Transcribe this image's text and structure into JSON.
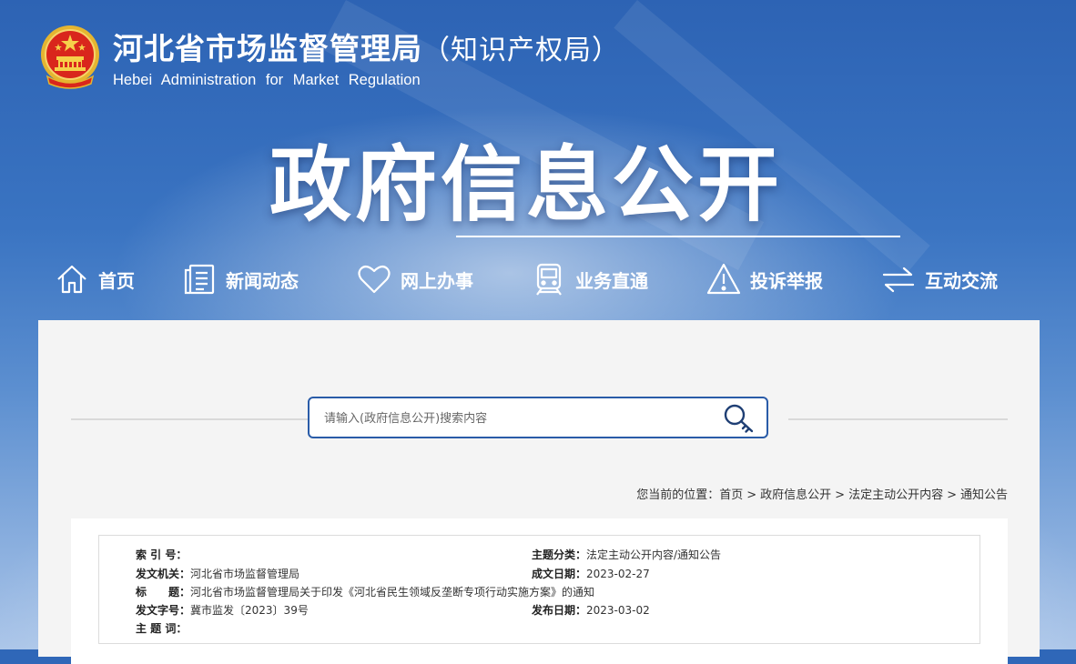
{
  "header": {
    "title": "河北省市场监督管理局",
    "title_paren": "（知识产权局）",
    "subtitle": "Hebei Administration for Market Regulation",
    "banner": "政府信息公开"
  },
  "nav": {
    "items": [
      {
        "label": "首页",
        "icon": "home-icon"
      },
      {
        "label": "新闻动态",
        "icon": "news-icon"
      },
      {
        "label": "网上办事",
        "icon": "heart-icon"
      },
      {
        "label": "业务直通",
        "icon": "train-icon"
      },
      {
        "label": "投诉举报",
        "icon": "warning-icon"
      },
      {
        "label": "互动交流",
        "icon": "swap-arrows-icon"
      }
    ]
  },
  "search": {
    "placeholder": "请输入(政府信息公开)搜索内容",
    "icon": "search-key-icon"
  },
  "breadcrumb": {
    "prefix": "您当前的位置：",
    "items": [
      "首页",
      "政府信息公开",
      "法定主动公开内容",
      "通知公告"
    ],
    "separator": ">"
  },
  "meta": {
    "index_label": "索 引 号：",
    "index_value": "",
    "category_label": "主题分类：",
    "category_value": "法定主动公开内容/通知公告",
    "issuer_label": "发文机关：",
    "issuer_value": "河北省市场监督管理局",
    "created_label": "成文日期：",
    "created_value": "2023-02-27",
    "title_label": "标　　题：",
    "title_value": "河北省市场监督管理局关于印发《河北省民生领域反垄断专项行动实施方案》的通知",
    "docno_label": "发文字号：",
    "docno_value": "冀市监发〔2023〕39号",
    "published_label": "发布日期：",
    "published_value": "2023-03-02",
    "keywords_label": "主 题 词：",
    "keywords_value": ""
  },
  "colors": {
    "header_blue": "#2f67b8",
    "search_border": "#2a5ca8",
    "panel_bg": "#f4f4f4"
  }
}
